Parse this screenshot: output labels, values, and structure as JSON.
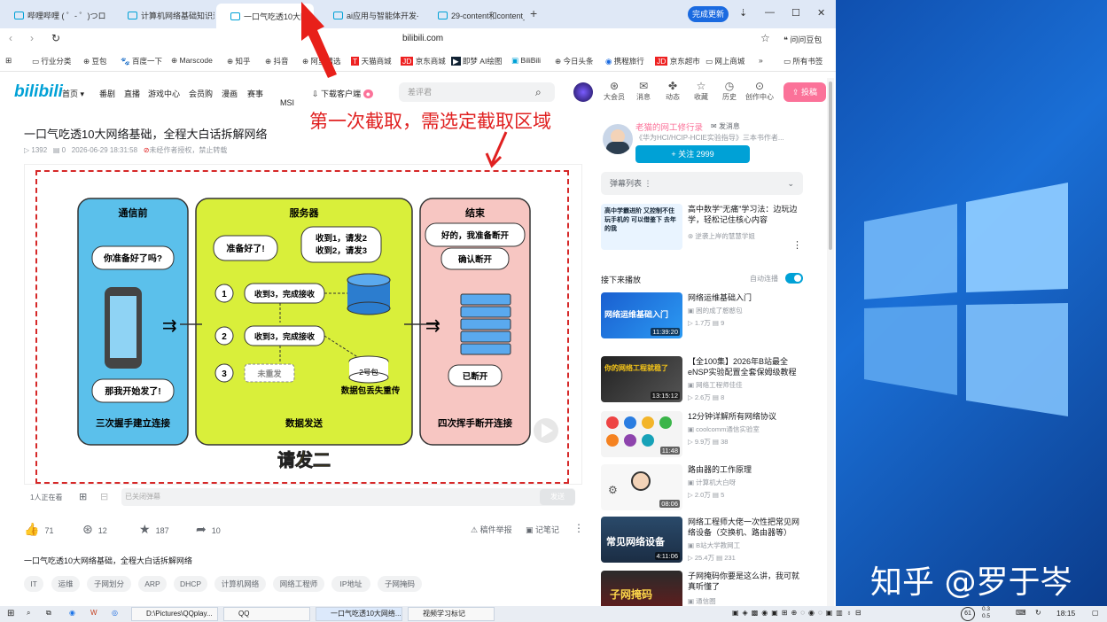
{
  "tabs": [
    {
      "label": "哔哩哔哩 ( ゜- ゜)つロ 干"
    },
    {
      "label": "计算机网络基础知识速成"
    },
    {
      "label": "一口气吃透10大网"
    },
    {
      "label": "ai应用与智能体开发-哔"
    },
    {
      "label": "29-content和content_"
    }
  ],
  "update_label": "完成更新",
  "url": "bilibili.com",
  "doubao_label": "问问豆包",
  "bookmarks": [
    "行业分类",
    "豆包",
    "百度一下",
    "Marscode",
    "知乎",
    "抖音",
    "阿里精选",
    "天猫商城",
    "京东商城",
    "即梦 AI绘图",
    "BiliBili",
    "今日头条",
    "携程旅行",
    "京东超市",
    "网上商城",
    "所有书签"
  ],
  "header": {
    "logo": "bilibili",
    "nav": [
      "首页",
      "番剧",
      "直播",
      "游戏中心",
      "会员购",
      "漫画",
      "赛事"
    ],
    "download": "下载客户端",
    "msi": "MSI",
    "search_placeholder": "差评君",
    "icons": [
      {
        "label": "大会员",
        "icon": "member-icon"
      },
      {
        "label": "消息",
        "icon": "message-icon"
      },
      {
        "label": "动态",
        "icon": "dynamic-icon"
      },
      {
        "label": "收藏",
        "icon": "favorite-icon"
      },
      {
        "label": "历史",
        "icon": "history-icon"
      },
      {
        "label": "创作中心",
        "icon": "creator-icon"
      }
    ],
    "upload": "投稿"
  },
  "video": {
    "title": "一口气吃透10大网络基础，全程大白话拆解网络",
    "views": "1392",
    "danmaku_count": "0",
    "date": "2026-06-29 18:31:58",
    "copyright": "未经作者授权，禁止转载",
    "online": "1人正在看",
    "danmaku_placeholder": "已关闭弹幕",
    "send": "发送",
    "likes": "71",
    "coins": "12",
    "favs": "187",
    "shares": "10",
    "report": "稿件举报",
    "note": "记笔记",
    "desc": "一口气吃透10大网络基础，全程大白话拆解网络",
    "tags": [
      "IT",
      "运维",
      "子网划分",
      "ARP",
      "DHCP",
      "计算机网络",
      "网络工程师",
      "IP地址",
      "子网掩码"
    ]
  },
  "annotation": "第一次截取，需选定截取区域",
  "diagram": {
    "panel1_title": "通信前",
    "panel1_bubble1": "你准备好了吗?",
    "panel1_bubble2": "那我开始发了!",
    "panel1_caption": "三次握手建立连接",
    "panel2_title": "服务器",
    "bubble_ready": "准备好了!",
    "bubble_recv1": "收到1，请发2",
    "bubble_recv2": "收到2，请发3",
    "step1": "1",
    "step1_text": "收到3，完成接收",
    "step2": "2",
    "step2_text": "收到3，完成接收",
    "step3": "3",
    "step3_text": "未重发",
    "pkg": "2号包",
    "loss": "数据包丢失重传",
    "panel2_caption": "数据发送",
    "panel3_title": "结束",
    "bubble_end1": "好的，我准备断开",
    "bubble_end2": "确认断开",
    "bubble_end3": "已断开",
    "panel3_caption": "四次挥手断开连接",
    "footer": "请发二"
  },
  "sidebar": {
    "author_name": "老猫的网工修行录",
    "author_msg": "发消息",
    "author_desc": "《华为HCI/HCIP-HCIE实验指导》三本书作者...",
    "follow": "+ 关注 2999",
    "danmaku_list": "弹幕列表",
    "ad_title": "高中数学\"无痛\"学习法：边玩边学，轻松记住核心内容",
    "ad_user": "逆袭上岸的慧慧学姐",
    "ad_thumb_text": "高中学霸进阶 又控制不住玩手机的 可以借鉴下 去年的我",
    "next_label": "接下来播放",
    "autoplay": "自动连播",
    "videos": [
      {
        "title": "网络运维基础入门",
        "user": "困的成了憨憨包",
        "views": "1.7万",
        "dm": "9",
        "dur": "11:39:20",
        "thumb_text": "网络运维基础入门"
      },
      {
        "title": "【全100集】2026年B站最全eNSP实验配置全套保姆级教程",
        "user": "网络工程师佳佳",
        "views": "2.6万",
        "dm": "8",
        "dur": "13:15:12",
        "thumb_text": "你的网络工程就稳了"
      },
      {
        "title": "12分钟详解所有网络协议",
        "user": "coolcomm通信实验室",
        "views": "9.9万",
        "dm": "38",
        "dur": "11:48",
        "thumb_text": ""
      },
      {
        "title": "路由器的工作原理",
        "user": "计算机大白呀",
        "views": "2.0万",
        "dm": "5",
        "dur": "08:06",
        "thumb_text": ""
      },
      {
        "title": "网络工程师大佬一次性把常见网络设备（交换机、路由器等）",
        "user": "B站大学教网工",
        "views": "25.4万",
        "dm": "231",
        "dur": "4:11:06",
        "thumb_text": "常见网络设备"
      },
      {
        "title": "子网掩码你要是这么讲，我可就真听懂了",
        "user": "通信圈",
        "views": "",
        "dm": "",
        "dur": "",
        "thumb_text": "子网掩码"
      }
    ]
  },
  "taskbar": {
    "path": "D:\\Pictures\\QQplay...",
    "qq": "QQ",
    "browser": "一口气吃透10大网络...",
    "notes": "视频学习标记",
    "badge": "61",
    "time": "18:15",
    "net_up": "0.3",
    "net_down": "0.5"
  },
  "watermark": "知乎 @罗于岑",
  "colors": {
    "bili_blue": "#00a1d6",
    "bili_pink": "#fb7299",
    "annotation_red": "#e02020",
    "panel1": "#5bc0eb",
    "panel2": "#d9ef3a",
    "panel3": "#f7c6c2"
  }
}
